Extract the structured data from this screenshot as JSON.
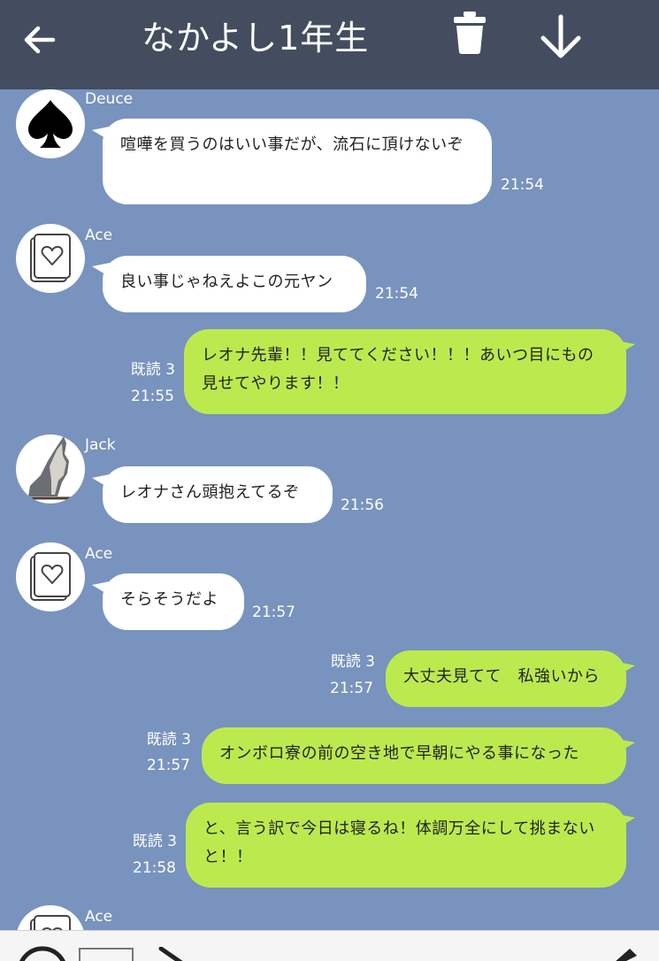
{
  "header": {
    "title": "なかよし1年生"
  },
  "messages": [
    {
      "sender": "Deuce",
      "text": "喧嘩を買うのはいい事だが、流石に頂けないぞ",
      "time": "21:54"
    },
    {
      "sender": "Ace",
      "text": "良い事じゃねえよこの元ヤン",
      "time": "21:54"
    },
    {
      "read": "既読 3",
      "text": "レオナ先輩！！見ててください！！！あいつ目にもの見せてやります！！",
      "time": "21:55"
    },
    {
      "sender": "Jack",
      "text": "レオナさん頭抱えてるぞ",
      "time": "21:56"
    },
    {
      "sender": "Ace",
      "text": "そらそうだよ",
      "time": "21:57"
    },
    {
      "read": "既読 3",
      "text": "大丈夫見てて　私強いから",
      "time": "21:57"
    },
    {
      "read": "既読 3",
      "text": "オンボロ寮の前の空き地で早朝にやる事になった",
      "time": "21:57"
    },
    {
      "read": "既読 3",
      "text": "と、言う訳で今日は寝るね！体調万全にして挑まないと！！",
      "time": "21:58"
    },
    {
      "sender": "Ace"
    }
  ],
  "colors": {
    "header_bg": "#434d5f",
    "chat_bg": "#7893be",
    "incoming_bubble": "#ffffff",
    "outgoing_bubble": "#bcea4e"
  },
  "icons": [
    "back-arrow-icon",
    "trash-icon",
    "download-arrow-icon",
    "spade-avatar-icon",
    "heart-card-avatar-icon",
    "wolf-avatar-icon",
    "circle-icon",
    "square-icon",
    "slash-icon",
    "pencil-icon"
  ]
}
